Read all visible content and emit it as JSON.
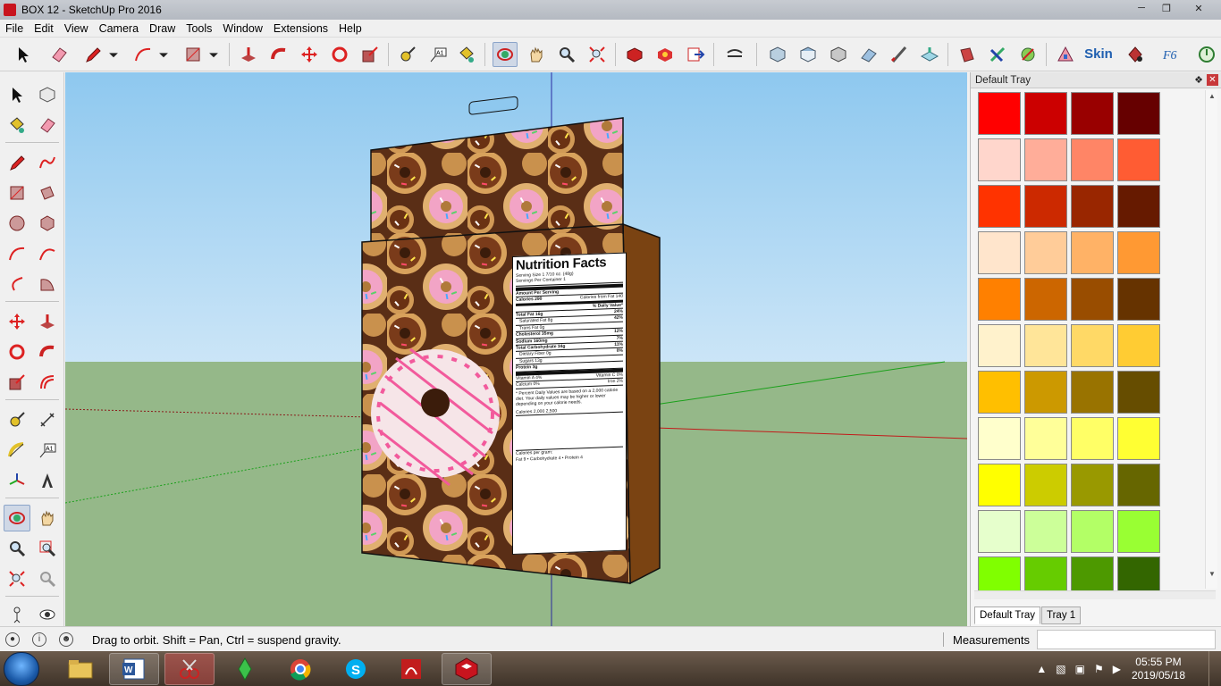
{
  "window": {
    "title": "BOX 12 - SketchUp Pro 2016",
    "controls": [
      "minimize",
      "restore",
      "close"
    ]
  },
  "menu": [
    "File",
    "Edit",
    "View",
    "Camera",
    "Draw",
    "Tools",
    "Window",
    "Extensions",
    "Help"
  ],
  "toolbar": {
    "icons": [
      "select-icon",
      "eraser-icon",
      "pencil-icon",
      "dropdown-icon",
      "arc-icon",
      "dropdown-icon",
      "rectangle-icon",
      "dropdown-icon",
      "push-pull-icon",
      "follow-me-icon",
      "move-icon",
      "rotate-icon",
      "scale-icon",
      "tape-measure-icon",
      "text-icon",
      "paint-bucket-icon",
      "orbit-icon",
      "pan-icon",
      "zoom-icon",
      "zoom-extents-icon",
      "3d-warehouse-icon",
      "extension-warehouse-icon",
      "send-to-layout-icon",
      "hide-rest-icon",
      "iso-view-icon",
      "top-view-icon",
      "front-view-icon",
      "right-view-icon",
      "back-view-icon",
      "left-view-icon",
      "section-plane-icon",
      "section-fill-icon",
      "sandbox-icon",
      "texture-icon",
      "extension-icon",
      "skin-icon",
      "plugin-icon",
      "formula-icon",
      "power-icon"
    ],
    "skin_label": "Skin"
  },
  "left_tools": [
    "select-icon",
    "make-component-icon",
    "paint-bucket-icon",
    "eraser-icon",
    "line-icon",
    "freehand-icon",
    "rectangle-icon",
    "rotated-rectangle-icon",
    "circle-icon",
    "polygon-icon",
    "arc-icon",
    "2-point-arc-icon",
    "3-point-arc-icon",
    "pie-icon",
    "move-icon",
    "push-pull-icon",
    "rotate-icon",
    "follow-me-icon",
    "scale-icon",
    "offset-icon",
    "tape-measure-icon",
    "dimension-icon",
    "protractor-icon",
    "text-icon",
    "axes-icon",
    "3d-text-icon",
    "orbit-icon",
    "pan-icon",
    "zoom-icon",
    "zoom-window-icon",
    "zoom-extents-icon",
    "previous-view-icon",
    "position-camera-icon",
    "look-around-icon"
  ],
  "tray": {
    "title": "Default Tray",
    "tabs": [
      "Default Tray",
      "Tray 1"
    ],
    "colors": [
      [
        "#ff0000",
        "#cc0000",
        "#990000",
        "#660000"
      ],
      [
        "#ffd6cc",
        "#ffad99",
        "#ff8566",
        "#ff5c33"
      ],
      [
        "#ff3300",
        "#cc2900",
        "#992600",
        "#661a00"
      ],
      [
        "#ffe5cc",
        "#ffcc99",
        "#ffb266",
        "#ff9933"
      ],
      [
        "#ff8000",
        "#cc6600",
        "#994d00",
        "#663300"
      ],
      [
        "#fff2cc",
        "#ffe599",
        "#ffd966",
        "#ffcc33"
      ],
      [
        "#ffbf00",
        "#cc9900",
        "#997300",
        "#664d00"
      ],
      [
        "#ffffcc",
        "#ffff99",
        "#ffff66",
        "#ffff33"
      ],
      [
        "#ffff00",
        "#cccc00",
        "#999900",
        "#666600"
      ],
      [
        "#e6ffcc",
        "#ccff99",
        "#b3ff66",
        "#99ff33"
      ],
      [
        "#80ff00",
        "#66cc00",
        "#4d9900",
        "#336600"
      ]
    ]
  },
  "box": {
    "nutrition": {
      "title": "Nutrition Facts",
      "serving_size": "Serving Size  1 7/10 oz. (48g)",
      "servings_per_container": "Servings Per Container  1",
      "amount_per_serving": "Amount Per Serving",
      "calories": "Calories  290",
      "calories_from_fat": "Calories from Fat  140",
      "daily_value_header": "% Daily Value*",
      "rows": [
        {
          "label": "Total Fat  16g",
          "value": "24%",
          "bold": true
        },
        {
          "label": "Saturated Fat  8g",
          "value": "42%",
          "bold": false
        },
        {
          "label": "Trans Fat  0g",
          "value": "",
          "bold": false
        },
        {
          "label": "Cholesterol  35mg",
          "value": "12%",
          "bold": true
        },
        {
          "label": "Sodium  160mg",
          "value": "7%",
          "bold": true
        },
        {
          "label": "Total Carbohydrate  34g",
          "value": "11%",
          "bold": true
        },
        {
          "label": "Dietary Fiber  0g",
          "value": "0%",
          "bold": false
        },
        {
          "label": "Sugars  13g",
          "value": "",
          "bold": false
        },
        {
          "label": "Protein  3g",
          "value": "",
          "bold": true
        }
      ],
      "vitamin_a": "Vitamin A  4%",
      "vitamin_c": "Vitamin C  0%",
      "calcium": "Calcium  0%",
      "iron": "Iron  2%",
      "footnote": "* Percent Daily Values are based on a 2,000 calorie diet. Your daily values may be higher or lower depending on your calorie needs.",
      "calories_line": "Calories    2,000    2,500",
      "per_gram": "Calories per gram:",
      "per_gram_values": "Fat 9  •  Carbohydrate 4  •  Protein 4"
    }
  },
  "status": {
    "hint": "Drag to orbit. Shift = Pan, Ctrl = suspend gravity.",
    "measurements_label": "Measurements",
    "measurements_value": ""
  },
  "taskbar": {
    "apps": [
      "file-explorer-icon",
      "word-icon",
      "snipping-tool-icon",
      "sims-icon",
      "chrome-icon",
      "skype-icon",
      "acrobat-icon",
      "sketchup-icon"
    ],
    "time": "05:55 PM",
    "date": "2019/05/18"
  }
}
